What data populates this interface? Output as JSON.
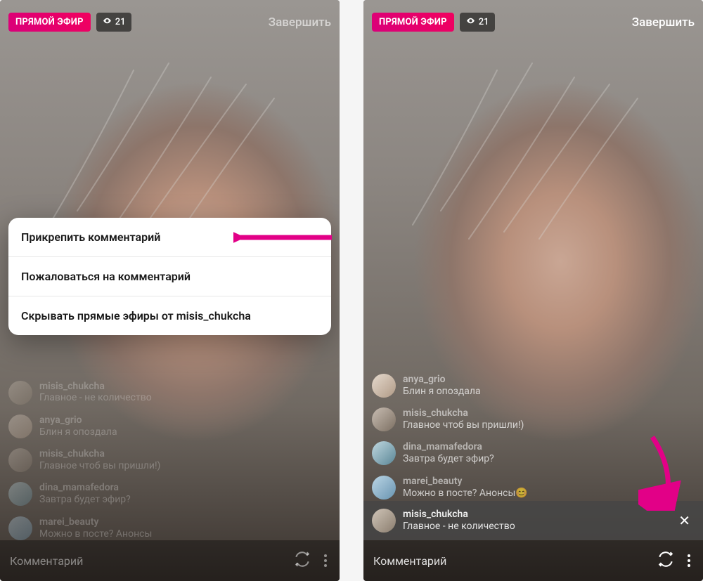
{
  "left": {
    "live_badge": "ПРЯМОЙ ЭФИР",
    "viewer_count": "21",
    "end_label": "Завершить",
    "menu": {
      "pin": "Прикрепить комментарий",
      "report": "Пожаловаться на комментарий",
      "hide": "Скрывать прямые эфиры от misis_chukcha"
    },
    "comments": [
      {
        "user": "misis_chukcha",
        "text": "Главное - не количество"
      },
      {
        "user": "anya_grio",
        "text": "Блин я опоздала"
      },
      {
        "user": "misis_chukcha",
        "text": "Главное чтоб вы пришли!)"
      },
      {
        "user": "dina_mamafedora",
        "text": "Завтра будет эфир?"
      },
      {
        "user": "marei_beauty",
        "text": "Можно в посте? Анонсы"
      }
    ],
    "input_placeholder": "Комментарий"
  },
  "right": {
    "live_badge": "ПРЯМОЙ ЭФИР",
    "viewer_count": "21",
    "end_label": "Завершить",
    "comments": [
      {
        "user": "anya_grio",
        "text": "Блин я опоздала"
      },
      {
        "user": "misis_chukcha",
        "text": "Главное чтоб вы пришли!)"
      },
      {
        "user": "dina_mamafedora",
        "text": "Завтра будет эфир?"
      },
      {
        "user": "marei_beauty",
        "text": "Можно в посте? Анонсы😊"
      }
    ],
    "pinned": {
      "user": "misis_chukcha",
      "text": "Главное - не количество"
    },
    "input_placeholder": "Комментарий"
  }
}
